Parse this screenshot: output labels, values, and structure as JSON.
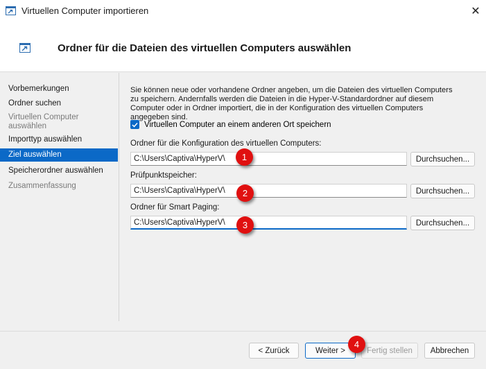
{
  "window": {
    "title": "Virtuellen Computer importieren",
    "close_glyph": "✕"
  },
  "header": {
    "title": "Ordner für die Dateien des virtuellen Computers auswählen"
  },
  "sidebar": {
    "items": [
      {
        "label": "Vorbemerkungen",
        "state": "normal"
      },
      {
        "label": "Ordner suchen",
        "state": "normal"
      },
      {
        "label": "Virtuellen Computer auswählen",
        "state": "disabled"
      },
      {
        "label": "Importtyp auswählen",
        "state": "normal"
      },
      {
        "label": "Ziel auswählen",
        "state": "selected"
      },
      {
        "label": "Speicherordner auswählen",
        "state": "normal"
      },
      {
        "label": "Zusammenfassung",
        "state": "disabled"
      }
    ]
  },
  "content": {
    "description": "Sie können neue oder vorhandene Ordner angeben, um die Dateien des virtuellen Computers zu speichern. Andernfalls werden die Dateien in die Hyper-V-Standardordner auf diesem Computer oder in Ordner importiert, die in der Konfiguration des virtuellen Computers angegeben sind.",
    "checkbox_label": "Virtuellen Computer an einem anderen Ort speichern",
    "checkbox_checked": true,
    "fields": [
      {
        "label": "Ordner für die Konfiguration des virtuellen Computers:",
        "value": "C:\\Users\\Captiva\\HyperV\\",
        "browse_label": "Durchsuchen...",
        "marker": "1"
      },
      {
        "label": "Prüfpunktspeicher:",
        "value": "C:\\Users\\Captiva\\HyperV\\",
        "browse_label": "Durchsuchen...",
        "marker": "2"
      },
      {
        "label": "Ordner für Smart Paging:",
        "value": "C:\\Users\\Captiva\\HyperV\\",
        "browse_label": "Durchsuchen...",
        "marker": "3"
      }
    ]
  },
  "footer": {
    "back_label": "< Zurück",
    "next_label": "Weiter >",
    "finish_label": "Fertig stellen",
    "cancel_label": "Abbrechen",
    "marker": "4"
  },
  "colors": {
    "accent": "#0b69c7",
    "marker": "#e01010"
  }
}
